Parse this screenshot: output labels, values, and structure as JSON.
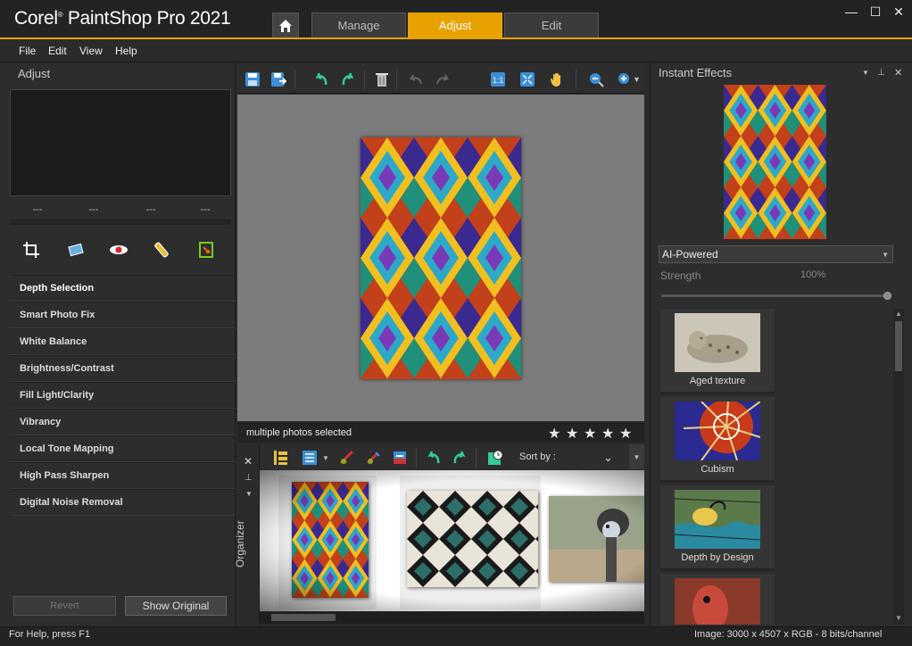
{
  "app": {
    "brand": "Corel",
    "title": "PaintShop Pro 2021"
  },
  "tabs": [
    {
      "label": "Manage",
      "active": false
    },
    {
      "label": "Adjust",
      "active": true
    },
    {
      "label": "Edit",
      "active": false
    }
  ],
  "window_controls": {
    "minimize": "—",
    "maximize": "☐",
    "close": "✕"
  },
  "menu": [
    "File",
    "Edit",
    "View",
    "Help"
  ],
  "left_panel": {
    "header": "Adjust",
    "histogram_values": [
      "---",
      "---",
      "---",
      "---"
    ],
    "tools": [
      "crop-icon",
      "straighten-icon",
      "red-eye-icon",
      "retouch-icon",
      "resize-icon"
    ],
    "adjustments": [
      "Depth Selection",
      "Smart Photo Fix",
      "White Balance",
      "Brightness/Contrast",
      "Fill Light/Clarity",
      "Vibrancy",
      "Local Tone Mapping",
      "High Pass Sharpen",
      "Digital Noise Removal"
    ],
    "revert_label": "Revert",
    "show_original_label": "Show Original"
  },
  "center": {
    "status_text": "multiple photos selected",
    "rating_stars": 5,
    "star_char": "★",
    "sort_by_label": "Sort by :",
    "organizer_label": "Organizer"
  },
  "right_panel": {
    "header": "Instant Effects",
    "category": "AI-Powered",
    "strength_label": "Strength",
    "strength_value": "100%",
    "strength_fraction": 1.0,
    "effects": [
      "Aged texture",
      "Cubism",
      "Depth by Design",
      ""
    ]
  },
  "status": {
    "help": "For Help, press F1",
    "image_info": "Image:  3000 x 4507 x RGB - 8 bits/channel"
  },
  "colors": {
    "accent": "#e8a200",
    "panel": "#2d2d2d",
    "canvas": "#7c7c7c"
  }
}
